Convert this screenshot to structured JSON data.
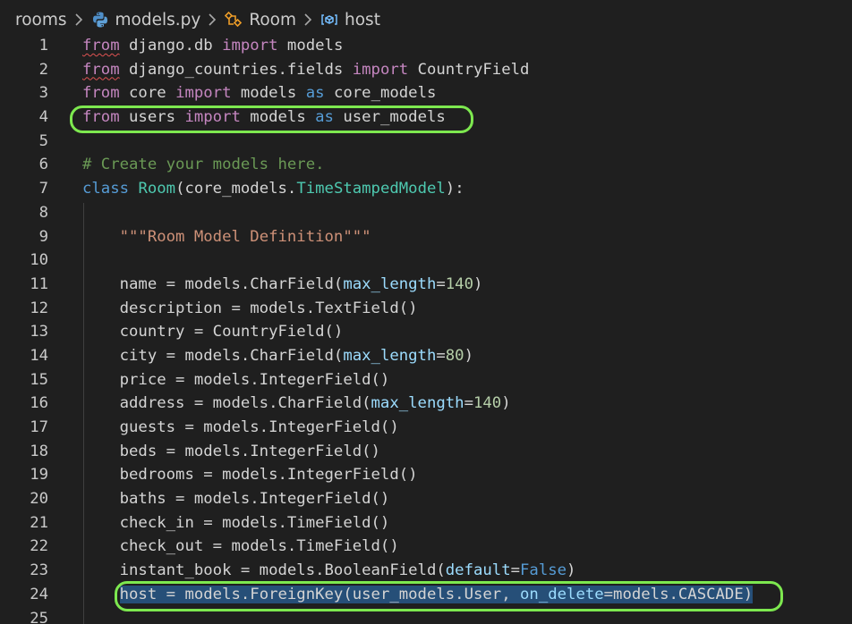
{
  "breadcrumb": {
    "items": [
      {
        "label": "rooms",
        "icon": ""
      },
      {
        "label": "models.py",
        "icon": "python-file-icon"
      },
      {
        "label": "Room",
        "icon": "class-icon"
      },
      {
        "label": "host",
        "icon": "variable-icon"
      }
    ]
  },
  "editor": {
    "language": "python",
    "selected_line": 24,
    "highlighted_lines": [
      4,
      24
    ],
    "lines": [
      {
        "n": "1",
        "tokens": [
          [
            "from",
            "kw squig"
          ],
          [
            " django.db ",
            "plain"
          ],
          [
            "import",
            "kw"
          ],
          [
            " models",
            "plain"
          ]
        ]
      },
      {
        "n": "2",
        "tokens": [
          [
            "from",
            "kw squig"
          ],
          [
            " django_countries.fields ",
            "plain"
          ],
          [
            "import",
            "kw"
          ],
          [
            " CountryField",
            "plain"
          ]
        ]
      },
      {
        "n": "3",
        "tokens": [
          [
            "from",
            "kw"
          ],
          [
            " core ",
            "plain"
          ],
          [
            "import",
            "kw"
          ],
          [
            " models ",
            "plain"
          ],
          [
            "as",
            "kwb"
          ],
          [
            " core_models",
            "plain"
          ]
        ]
      },
      {
        "n": "4",
        "tokens": [
          [
            "from",
            "kw"
          ],
          [
            " users ",
            "plain"
          ],
          [
            "import",
            "kw"
          ],
          [
            " models ",
            "plain"
          ],
          [
            "as",
            "kwb"
          ],
          [
            " user_models",
            "plain"
          ]
        ]
      },
      {
        "n": "5",
        "tokens": []
      },
      {
        "n": "6",
        "tokens": [
          [
            "# Create your models here.",
            "cmt"
          ]
        ]
      },
      {
        "n": "7",
        "tokens": [
          [
            "class",
            "kwb"
          ],
          [
            " ",
            "plain"
          ],
          [
            "Room",
            "cls"
          ],
          [
            "(core_models.",
            "plain"
          ],
          [
            "TimeStampedModel",
            "cls"
          ],
          [
            "):",
            "plain"
          ]
        ]
      },
      {
        "n": "8",
        "tokens": []
      },
      {
        "n": "9",
        "tokens": [
          [
            "    ",
            "plain"
          ],
          [
            "\"\"\"Room Model Definition\"\"\"",
            "str"
          ]
        ]
      },
      {
        "n": "10",
        "tokens": []
      },
      {
        "n": "11",
        "tokens": [
          [
            "    name = models.CharField(",
            "plain"
          ],
          [
            "max_length",
            "param"
          ],
          [
            "=",
            "plain"
          ],
          [
            "140",
            "num"
          ],
          [
            ")",
            "plain"
          ]
        ]
      },
      {
        "n": "12",
        "tokens": [
          [
            "    description = models.TextField()",
            "plain"
          ]
        ]
      },
      {
        "n": "13",
        "tokens": [
          [
            "    country = CountryField()",
            "plain"
          ]
        ]
      },
      {
        "n": "14",
        "tokens": [
          [
            "    city = models.CharField(",
            "plain"
          ],
          [
            "max_length",
            "param"
          ],
          [
            "=",
            "plain"
          ],
          [
            "80",
            "num"
          ],
          [
            ")",
            "plain"
          ]
        ]
      },
      {
        "n": "15",
        "tokens": [
          [
            "    price = models.IntegerField()",
            "plain"
          ]
        ]
      },
      {
        "n": "16",
        "tokens": [
          [
            "    address = models.CharField(",
            "plain"
          ],
          [
            "max_length",
            "param"
          ],
          [
            "=",
            "plain"
          ],
          [
            "140",
            "num"
          ],
          [
            ")",
            "plain"
          ]
        ]
      },
      {
        "n": "17",
        "tokens": [
          [
            "    guests = models.IntegerField()",
            "plain"
          ]
        ]
      },
      {
        "n": "18",
        "tokens": [
          [
            "    beds = models.IntegerField()",
            "plain"
          ]
        ]
      },
      {
        "n": "19",
        "tokens": [
          [
            "    bedrooms = models.IntegerField()",
            "plain"
          ]
        ]
      },
      {
        "n": "20",
        "tokens": [
          [
            "    baths = models.IntegerField()",
            "plain"
          ]
        ]
      },
      {
        "n": "21",
        "tokens": [
          [
            "    check_in = models.TimeField()",
            "plain"
          ]
        ]
      },
      {
        "n": "22",
        "tokens": [
          [
            "    check_out = models.TimeField()",
            "plain"
          ]
        ]
      },
      {
        "n": "23",
        "tokens": [
          [
            "    instant_book = models.BooleanField(",
            "plain"
          ],
          [
            "default",
            "param"
          ],
          [
            "=",
            "plain"
          ],
          [
            "False",
            "kwb"
          ],
          [
            ")",
            "plain"
          ]
        ]
      },
      {
        "n": "24",
        "tokens": [
          [
            "    ",
            "plain"
          ],
          [
            "host = models.ForeignKey(user_models.User, ",
            "plain sel"
          ],
          [
            "on_delete",
            "param sel"
          ],
          [
            "=models.CASCADE)",
            "plain sel"
          ]
        ]
      },
      {
        "n": "25",
        "tokens": []
      }
    ]
  },
  "colors": {
    "background": "#1f1f1f",
    "highlight_outline": "#7de84f",
    "selection": "#264f78",
    "keyword": "#c586c0",
    "keyword_blue": "#569cd6",
    "class_name": "#4ec9b0",
    "string": "#ce9178",
    "comment": "#6a9955"
  }
}
